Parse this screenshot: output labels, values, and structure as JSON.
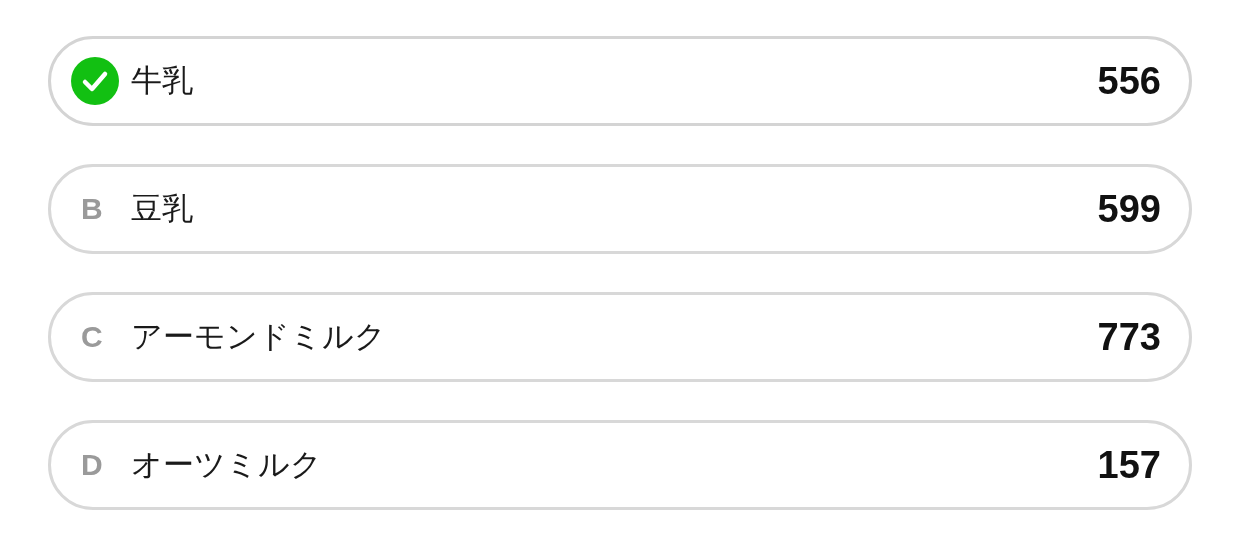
{
  "options": [
    {
      "label": "牛乳",
      "count": "556",
      "selected": true
    },
    {
      "letter": "B",
      "label": "豆乳",
      "count": "599",
      "selected": false
    },
    {
      "letter": "C",
      "label": "アーモンドミルク",
      "count": "773",
      "selected": false
    },
    {
      "letter": "D",
      "label": "オーツミルク",
      "count": "157",
      "selected": false
    }
  ]
}
